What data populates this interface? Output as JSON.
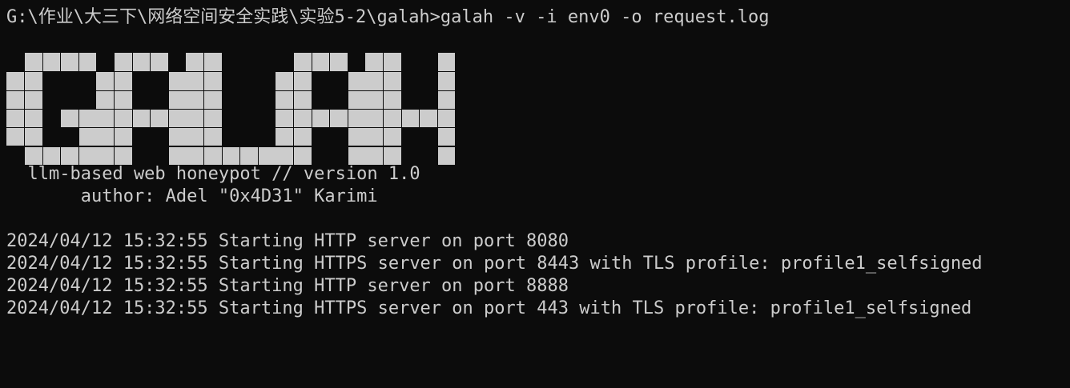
{
  "terminal": {
    "prompt_line": "G:\\作业\\大三下\\网络空间安全实践\\实验5-2\\galah>galah -v -i env0 -o request.log",
    "banner_text": "GALAH",
    "tagline": "  llm-based web honeypot // version 1.0",
    "author": "       author: Adel \"0x4D31\" Karimi",
    "log_lines": [
      "2024/04/12 15:32:55 Starting HTTP server on port 8080",
      "2024/04/12 15:32:55 Starting HTTPS server on port 8443 with TLS profile: profile1_selfsigned",
      "2024/04/12 15:32:55 Starting HTTP server on port 8888",
      "2024/04/12 15:32:55 Starting HTTPS server on port 443 with TLS profile: profile1_selfsigned"
    ],
    "colors": {
      "background": "#0c0c0c",
      "foreground": "#cccccc"
    }
  }
}
